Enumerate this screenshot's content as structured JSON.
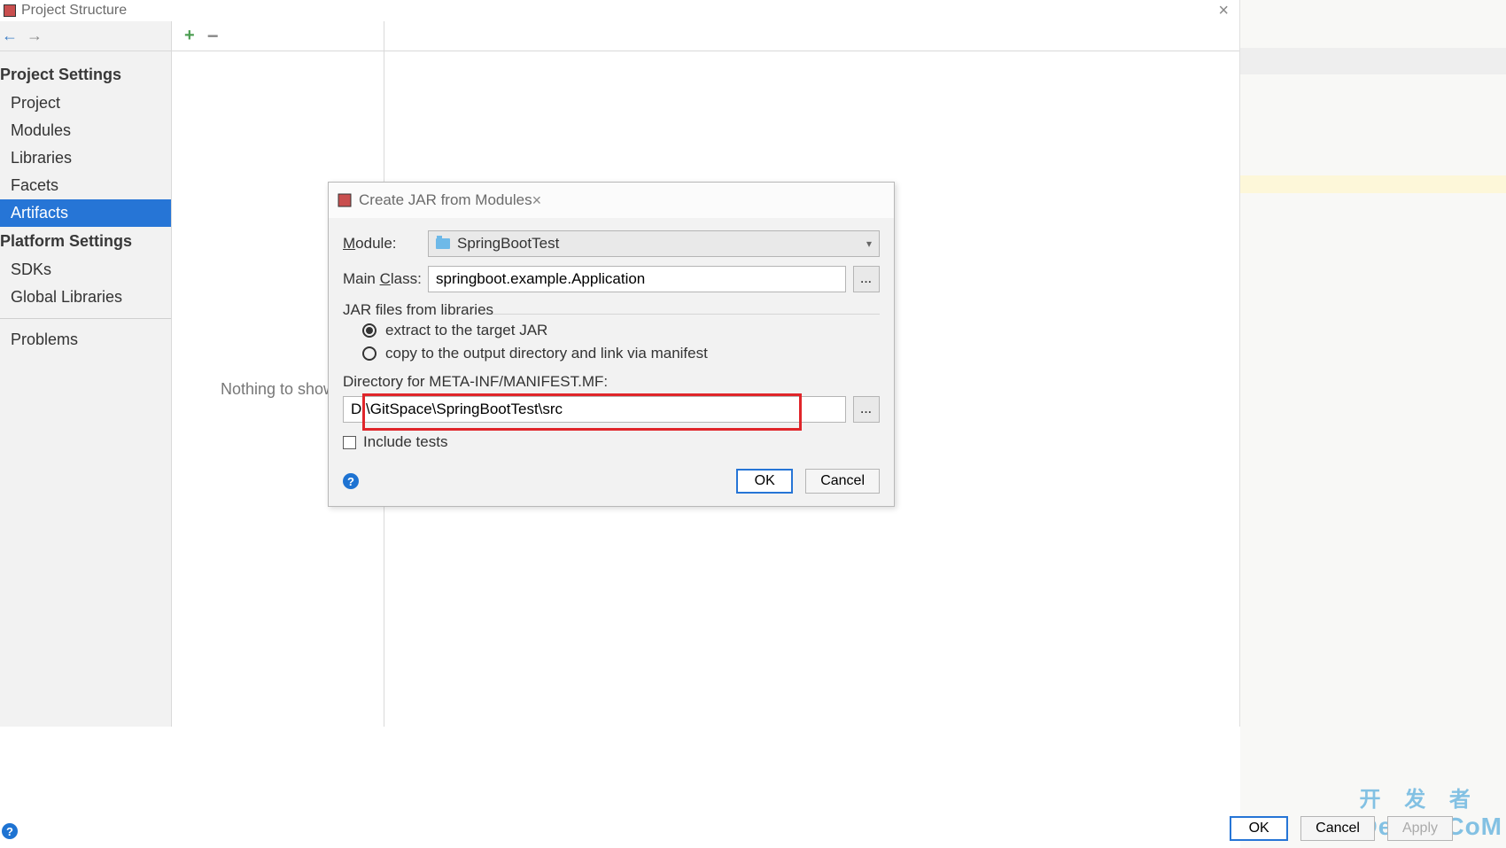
{
  "window": {
    "title": "Project Structure"
  },
  "sidebar": {
    "sections": {
      "project_settings_label": "Project Settings",
      "platform_settings_label": "Platform Settings"
    },
    "project": "Project",
    "modules": "Modules",
    "libraries": "Libraries",
    "facets": "Facets",
    "artifacts": "Artifacts",
    "sdks": "SDKs",
    "global_libraries": "Global Libraries",
    "problems": "Problems"
  },
  "middle": {
    "placeholder": "Nothing to show"
  },
  "dialog": {
    "title": "Create JAR from Modules",
    "module_label": "Module:",
    "module_value": "SpringBootTest",
    "main_class_label": "Main Class:",
    "main_class_value": "springboot.example.Application",
    "jar_files_label": "JAR files from libraries",
    "extract_label": "extract to the target JAR",
    "copy_label": "copy to the output directory and link via manifest",
    "directory_label": "Directory for META-INF/MANIFEST.MF:",
    "directory_value": "D:\\GitSpace\\SpringBootTest\\src",
    "include_tests_label": "Include tests",
    "ok_label": "OK",
    "cancel_label": "Cancel",
    "browse_label": "..."
  },
  "footer": {
    "ok": "OK",
    "cancel": "Cancel",
    "apply": "Apply"
  },
  "watermark": {
    "zh": "开 发 者",
    "en": "DevZe.CoM"
  }
}
